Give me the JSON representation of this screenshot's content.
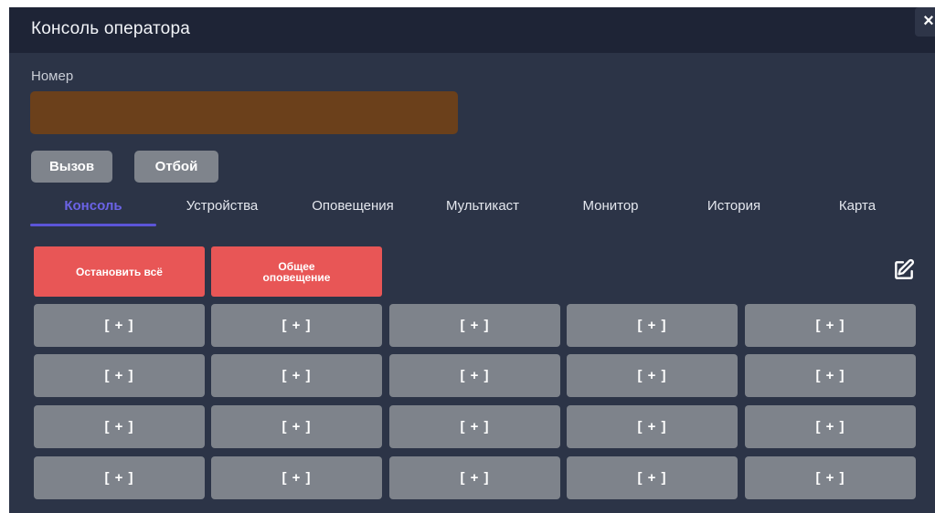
{
  "window": {
    "title": "Консоль оператора",
    "close_label": "×"
  },
  "number_field": {
    "label": "Номер",
    "value": "",
    "color": "#6b401b"
  },
  "actions": {
    "call_label": "Вызов",
    "hangup_label": "Отбой"
  },
  "tabs": [
    {
      "label": "Консоль",
      "active": true
    },
    {
      "label": "Устройства",
      "active": false
    },
    {
      "label": "Оповещения",
      "active": false
    },
    {
      "label": "Мультикаст",
      "active": false
    },
    {
      "label": "Монитор",
      "active": false
    },
    {
      "label": "История",
      "active": false
    },
    {
      "label": "Карта",
      "active": false
    }
  ],
  "console": {
    "stop_all_label": "Остановить всё",
    "broadcast_label": "Общее\nоповещение",
    "edit_icon": "edit-icon",
    "slot_label": "[ + ]",
    "rows": 4,
    "cols": 5
  },
  "colors": {
    "accent": "#5c55d8",
    "danger": "#e85656",
    "slot": "#7e838b",
    "panel": "#2c3447",
    "titlebar": "#1e2436"
  }
}
